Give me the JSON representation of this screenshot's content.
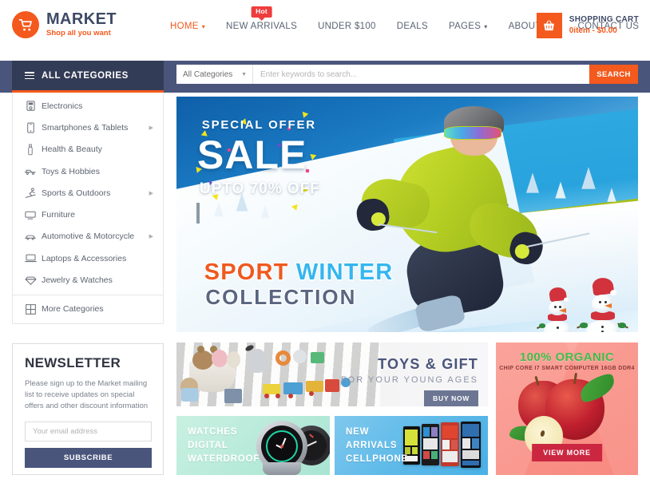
{
  "brand": {
    "name": "MARKET",
    "tagline": "Shop all you want",
    "logo_icon": "shopping-cart-icon",
    "logo_color": "#f4591d",
    "text_color": "#3e4a66"
  },
  "nav": {
    "items": [
      {
        "label": "HOME",
        "active": true,
        "has_caret": true,
        "badge": null
      },
      {
        "label": "NEW ARRIVALS",
        "active": false,
        "has_caret": false,
        "badge": "Hot"
      },
      {
        "label": "UNDER $100",
        "active": false,
        "has_caret": false,
        "badge": null
      },
      {
        "label": "DEALS",
        "active": false,
        "has_caret": false,
        "badge": null
      },
      {
        "label": "PAGES",
        "active": false,
        "has_caret": true,
        "badge": null
      },
      {
        "label": "ABOUT US",
        "active": false,
        "has_caret": false,
        "badge": null
      },
      {
        "label": "CONTACT US",
        "active": false,
        "has_caret": false,
        "badge": null
      }
    ],
    "badge_color": "#ef3d3d",
    "active_color": "#f4591d"
  },
  "cart": {
    "icon": "basket-icon",
    "title": "SHOPPING CART",
    "summary": "0item  -  $0.00",
    "accent": "#f4591d"
  },
  "categories_panel": {
    "header_label": "ALL CATEGORIES",
    "header_icon": "hamburger-icon",
    "header_bg": "#333c56",
    "header_underline": "#f4591d",
    "items": [
      {
        "label": "Electronics",
        "icon": "monitor-icon",
        "has_submenu": false
      },
      {
        "label": "Smartphones & Tablets",
        "icon": "smartphone-icon",
        "has_submenu": true
      },
      {
        "label": "Health & Beauty",
        "icon": "bottle-icon",
        "has_submenu": false
      },
      {
        "label": "Toys & Hobbies",
        "icon": "toy-car-icon",
        "has_submenu": false
      },
      {
        "label": "Sports & Outdoors",
        "icon": "skier-icon",
        "has_submenu": true
      },
      {
        "label": "Furniture",
        "icon": "desk-icon",
        "has_submenu": false
      },
      {
        "label": "Automotive & Motorcycle",
        "icon": "car-icon",
        "has_submenu": true
      },
      {
        "label": "Laptops & Accessories",
        "icon": "laptop-icon",
        "has_submenu": false
      },
      {
        "label": "Jewelry & Watches",
        "icon": "diamond-icon",
        "has_submenu": false
      }
    ],
    "more": {
      "label": "More Categories",
      "icon": "grid-icon"
    }
  },
  "search": {
    "category_value": "All Categories",
    "placeholder": "Enter keywords to search...",
    "value": "",
    "button_label": "SEARCH",
    "button_color": "#f4591d"
  },
  "newsletter": {
    "title": "NEWSLETTER",
    "description": "Please sign up to the Market mailing list to receive updates on special offers and other discount information",
    "email_placeholder": "Your email address",
    "email_value": "",
    "button_label": "SUBSCRIBE",
    "button_color": "#4a557c"
  },
  "hero": {
    "special_offer": "SPECIAL OFFER",
    "sale": "SALE",
    "upto": "UPTO 70% OFF",
    "title_word1": "SPORT",
    "title_word2": "WINTER",
    "title_line2": "COLLECTION",
    "word1_color": "#f0591f",
    "word2_color": "#35b6ef",
    "line2_color": "#5a6680",
    "scene": "skier-snow-mountain"
  },
  "promos": {
    "toys": {
      "title": "TOYS & GIFT",
      "subtitle": "FOR YOUR YOUNG AGES",
      "button_label": "BUY NOW",
      "button_color": "#6c7693",
      "title_color": "#4a557c"
    },
    "watches": {
      "line1": "WATCHES",
      "line2": "DIGITAL",
      "line3": "WATERDROOF",
      "bg_color": "#b7ead9"
    },
    "cellphone": {
      "line1": "NEW",
      "line2": "ARRIVALS",
      "line3": "CELLPHONE",
      "bg_color": "#5cb9e8"
    },
    "organic": {
      "title": "100% ORGANIC",
      "subtitle": "CHIP CORE I7 SMART COMPUTER 16GB DDR4",
      "button_label": "VIEW MORE",
      "button_color": "#cb2741",
      "title_color": "#3fbd4a",
      "bg_color": "#f99288"
    }
  }
}
